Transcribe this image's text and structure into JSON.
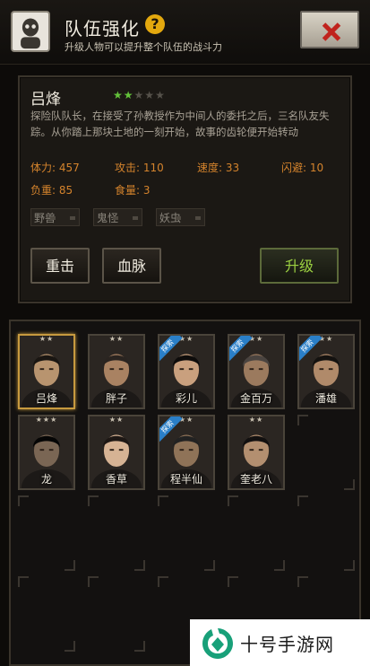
{
  "header": {
    "title": "队伍强化",
    "help_icon": "question-icon",
    "subtitle": "升级人物可以提升整个队伍的战斗力",
    "close_icon": "close-icon"
  },
  "hero": {
    "name": "吕烽",
    "stars_filled": 2,
    "stars_total": 5,
    "description": "探险队队长，在接受了孙教授作为中间人的委托之后，三名队友失踪。从你踏上那块土地的一刻开始，故事的齿轮便开始转动",
    "stats": [
      {
        "text": "体力: 457"
      },
      {
        "text": "攻击: 110"
      },
      {
        "text": "速度: 33"
      },
      {
        "text": "闪避: 10"
      },
      {
        "text": "负重: 85"
      },
      {
        "text": "食量: 3"
      }
    ],
    "tags": [
      "野兽",
      "鬼怪",
      "妖虫"
    ],
    "buttons": {
      "reset": "重击",
      "bloodline": "血脉",
      "upgrade": "升级"
    }
  },
  "roster": [
    {
      "name": "吕烽",
      "stars": "★★",
      "badge": "",
      "selected": true
    },
    {
      "name": "胖子",
      "stars": "★★",
      "badge": "",
      "selected": false
    },
    {
      "name": "彩儿",
      "stars": "★★",
      "badge": "探索",
      "selected": false
    },
    {
      "name": "金百万",
      "stars": "★★",
      "badge": "探索",
      "selected": false
    },
    {
      "name": "潘雄",
      "stars": "★★",
      "badge": "探索",
      "selected": false
    },
    {
      "name": "龙",
      "stars": "★★★",
      "badge": "",
      "selected": false
    },
    {
      "name": "香草",
      "stars": "★★",
      "badge": "",
      "selected": false
    },
    {
      "name": "程半仙",
      "stars": "★★",
      "badge": "探索",
      "selected": false
    },
    {
      "name": "奎老八",
      "stars": "★★",
      "badge": "",
      "selected": false
    }
  ],
  "watermark": {
    "text": "十号手游网"
  },
  "colors": {
    "accent_gold": "#c79a3f",
    "upgrade_green": "#9bd041",
    "stat_orange": "#d4832c",
    "explore_badge": "#2a7fc8"
  }
}
